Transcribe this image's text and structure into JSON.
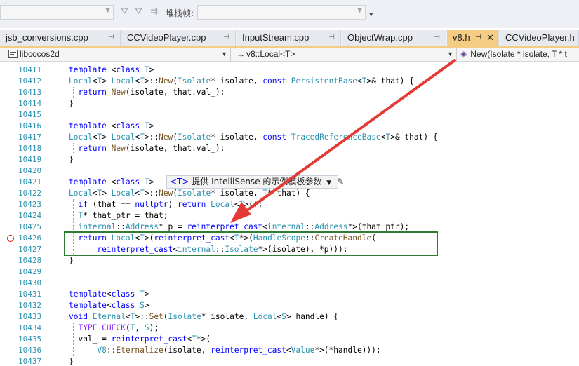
{
  "toolbar": {
    "stack_frame_label": "堆栈帧:",
    "filter_icon": "filter-icon",
    "filter_clear_icon": "filter-clear-icon",
    "thread_icon": "thread-flag-icon"
  },
  "tabs": [
    {
      "label": "jsb_conversions.cpp",
      "active": false
    },
    {
      "label": "CCVideoPlayer.cpp",
      "active": false
    },
    {
      "label": "InputStream.cpp",
      "active": false
    },
    {
      "label": "ObjectWrap.cpp",
      "active": false
    },
    {
      "label": "v8.h",
      "active": true
    },
    {
      "label": "CCVideoPlayer.h",
      "active": false
    }
  ],
  "navbar": {
    "project": "libcocos2d",
    "scope": "v8::Local<T>",
    "member": "New(Isolate * isolate, T * t"
  },
  "intellisense_tip": {
    "param": "<T>",
    "text": "提供 IntelliSense 的示例模板参数"
  },
  "colors": {
    "active_tab": "#f5cc84",
    "line_number": "#2b91af",
    "keyword": "#0000ff",
    "highlight_box": "#2e7d32",
    "annotation_arrow": "#e53935"
  },
  "code_lines": [
    {
      "n": "10411",
      "code": "template <class T>"
    },
    {
      "n": "10412",
      "code": "Local<T> Local<T>::New(Isolate* isolate, const PersistentBase<T>& that) {"
    },
    {
      "n": "10413",
      "code": "  return New(isolate, that.val_);"
    },
    {
      "n": "10414",
      "code": "}"
    },
    {
      "n": "10415",
      "code": ""
    },
    {
      "n": "10416",
      "code": "template <class T>"
    },
    {
      "n": "10417",
      "code": "Local<T> Local<T>::New(Isolate* isolate, const TracedReferenceBase<T>& that) {"
    },
    {
      "n": "10418",
      "code": "  return New(isolate, that.val_);"
    },
    {
      "n": "10419",
      "code": "}"
    },
    {
      "n": "10420",
      "code": ""
    },
    {
      "n": "10421",
      "code": "template <class T>"
    },
    {
      "n": "10422",
      "code": "Local<T> Local<T>::New(Isolate* isolate, T* that) {"
    },
    {
      "n": "10423",
      "code": "  if (that == nullptr) return Local<T>();"
    },
    {
      "n": "10424",
      "code": "  T* that_ptr = that;"
    },
    {
      "n": "10425",
      "code": "  internal::Address* p = reinterpret_cast<internal::Address*>(that_ptr);"
    },
    {
      "n": "10426",
      "code": "  return Local<T>(reinterpret_cast<T*>(HandleScope::CreateHandle("
    },
    {
      "n": "10427",
      "code": "      reinterpret_cast<internal::Isolate*>(isolate), *p)));"
    },
    {
      "n": "10428",
      "code": "}"
    },
    {
      "n": "10429",
      "code": ""
    },
    {
      "n": "10430",
      "code": ""
    },
    {
      "n": "10431",
      "code": "template<class T>"
    },
    {
      "n": "10432",
      "code": "template<class S>"
    },
    {
      "n": "10433",
      "code": "void Eternal<T>::Set(Isolate* isolate, Local<S> handle) {"
    },
    {
      "n": "10434",
      "code": "  TYPE_CHECK(T, S);"
    },
    {
      "n": "10435",
      "code": "  val_ = reinterpret_cast<T*>("
    },
    {
      "n": "10436",
      "code": "      V8::Eternalize(isolate, reinterpret_cast<Value*>(*handle)));"
    },
    {
      "n": "10437",
      "code": "}"
    }
  ]
}
